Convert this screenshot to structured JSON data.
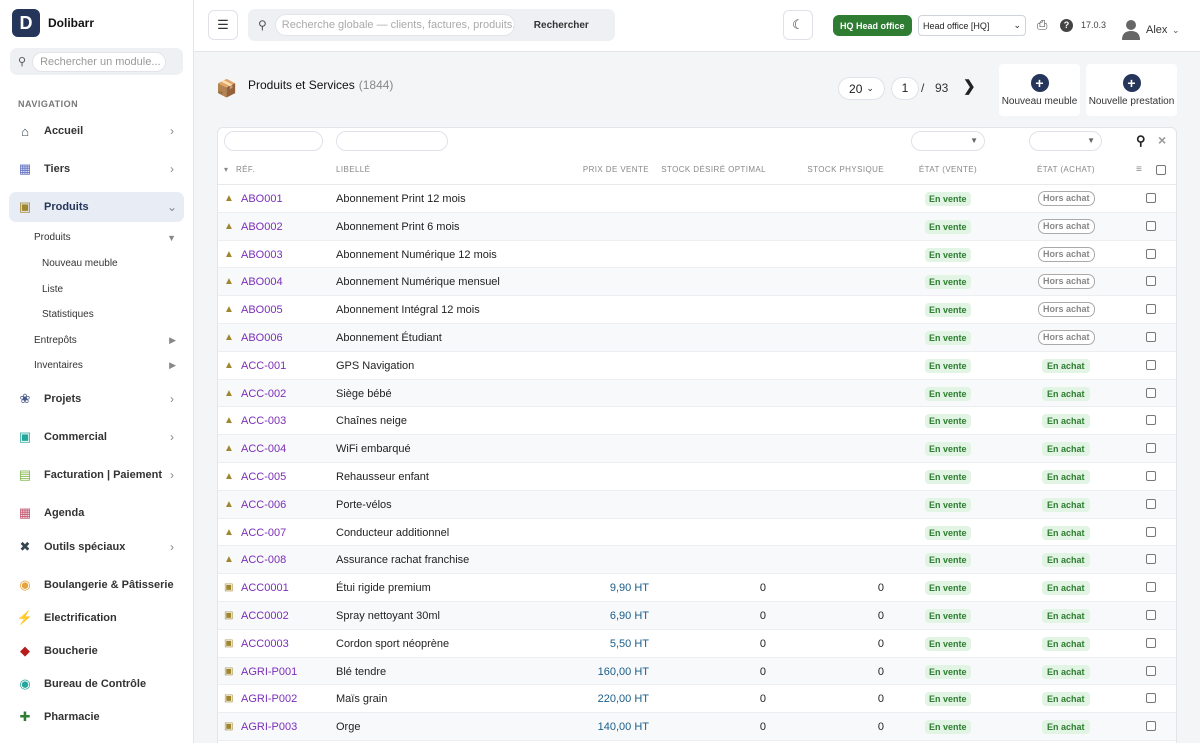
{
  "brand": {
    "logo_letter": "D",
    "name": "Dolibarr"
  },
  "module_search": {
    "placeholder": "Rechercher un module..."
  },
  "nav": {
    "heading": "NAVIGATION",
    "items": [
      {
        "label": "Accueil",
        "icon": "home-icon",
        "color": "#37474f"
      },
      {
        "label": "Tiers",
        "icon": "building-icon",
        "color": "#5c6bc0"
      },
      {
        "label": "Produits",
        "icon": "cube-icon",
        "color": "#a0872f"
      },
      {
        "label": "Projets",
        "icon": "project-icon",
        "color": "#4a5a8a"
      },
      {
        "label": "Commercial",
        "icon": "briefcase-icon",
        "color": "#26a69a"
      },
      {
        "label": "Facturation | Paiement",
        "icon": "invoice-icon",
        "color": "#7cb342"
      },
      {
        "label": "Agenda",
        "icon": "calendar-icon",
        "color": "#c0506a"
      },
      {
        "label": "Outils spéciaux",
        "icon": "tools-icon",
        "color": "#37474f"
      },
      {
        "label": "Boulangerie & Pâtisserie",
        "icon": "bread-icon",
        "color": "#e6a23c"
      },
      {
        "label": "Electrification",
        "icon": "bolt-icon",
        "color": "#f5b800"
      },
      {
        "label": "Boucherie",
        "icon": "meat-icon",
        "color": "#b71c1c"
      },
      {
        "label": "Bureau de Contrôle",
        "icon": "shield-icon",
        "color": "#26a69a"
      },
      {
        "label": "Pharmacie",
        "icon": "cross-icon",
        "color": "#2e7d32"
      }
    ],
    "sub": {
      "produits": "Produits",
      "nouveau": "Nouveau meuble",
      "liste": "Liste",
      "stats": "Statistiques",
      "entrepots": "Entrepôts",
      "inventaires": "Inventaires"
    }
  },
  "topbar": {
    "search_placeholder": "Recherche globale — clients, factures, produits...",
    "search_button": "Rechercher",
    "hq_badge": "HQ Head office",
    "entity": "Head office [HQ]",
    "version": "17.0.3",
    "user": "Alex"
  },
  "page": {
    "title": "Produits et Services",
    "count": "(1844)",
    "limit": "20",
    "page": "1",
    "sep": "/",
    "total_pages": "93",
    "action_new_product": "Nouveau meuble",
    "action_new_service": "Nouvelle prestation"
  },
  "table": {
    "headers": {
      "ref": "RÉF.",
      "label": "LIBELLÉ",
      "price": "PRIX DE VENTE",
      "stock_desired": "STOCK DÉSIRÉ OPTIMAL",
      "stock_physical": "STOCK PHYSIQUE",
      "state_sell": "ÉTAT (VENTE)",
      "state_buy": "ÉTAT (ACHAT)"
    },
    "rows": [
      {
        "type": "service",
        "ref": "ABO001",
        "label": "Abonnement Print 12 mois",
        "price": "",
        "desired": "",
        "physical": "",
        "sell": "En vente",
        "buy": "Hors achat",
        "buy_on": false
      },
      {
        "type": "service",
        "ref": "ABO002",
        "label": "Abonnement Print 6 mois",
        "price": "",
        "desired": "",
        "physical": "",
        "sell": "En vente",
        "buy": "Hors achat",
        "buy_on": false
      },
      {
        "type": "service",
        "ref": "ABO003",
        "label": "Abonnement Numérique 12 mois",
        "price": "",
        "desired": "",
        "physical": "",
        "sell": "En vente",
        "buy": "Hors achat",
        "buy_on": false
      },
      {
        "type": "service",
        "ref": "ABO004",
        "label": "Abonnement Numérique mensuel",
        "price": "",
        "desired": "",
        "physical": "",
        "sell": "En vente",
        "buy": "Hors achat",
        "buy_on": false
      },
      {
        "type": "service",
        "ref": "ABO005",
        "label": "Abonnement Intégral 12 mois",
        "price": "",
        "desired": "",
        "physical": "",
        "sell": "En vente",
        "buy": "Hors achat",
        "buy_on": false
      },
      {
        "type": "service",
        "ref": "ABO006",
        "label": "Abonnement Étudiant",
        "price": "",
        "desired": "",
        "physical": "",
        "sell": "En vente",
        "buy": "Hors achat",
        "buy_on": false
      },
      {
        "type": "service",
        "ref": "ACC-001",
        "label": "GPS Navigation",
        "price": "",
        "desired": "",
        "physical": "",
        "sell": "En vente",
        "buy": "En achat",
        "buy_on": true
      },
      {
        "type": "service",
        "ref": "ACC-002",
        "label": "Siège bébé",
        "price": "",
        "desired": "",
        "physical": "",
        "sell": "En vente",
        "buy": "En achat",
        "buy_on": true
      },
      {
        "type": "service",
        "ref": "ACC-003",
        "label": "Chaînes neige",
        "price": "",
        "desired": "",
        "physical": "",
        "sell": "En vente",
        "buy": "En achat",
        "buy_on": true
      },
      {
        "type": "service",
        "ref": "ACC-004",
        "label": "WiFi embarqué",
        "price": "",
        "desired": "",
        "physical": "",
        "sell": "En vente",
        "buy": "En achat",
        "buy_on": true
      },
      {
        "type": "service",
        "ref": "ACC-005",
        "label": "Rehausseur enfant",
        "price": "",
        "desired": "",
        "physical": "",
        "sell": "En vente",
        "buy": "En achat",
        "buy_on": true
      },
      {
        "type": "service",
        "ref": "ACC-006",
        "label": "Porte-vélos",
        "price": "",
        "desired": "",
        "physical": "",
        "sell": "En vente",
        "buy": "En achat",
        "buy_on": true
      },
      {
        "type": "service",
        "ref": "ACC-007",
        "label": "Conducteur additionnel",
        "price": "",
        "desired": "",
        "physical": "",
        "sell": "En vente",
        "buy": "En achat",
        "buy_on": true
      },
      {
        "type": "service",
        "ref": "ACC-008",
        "label": "Assurance rachat franchise",
        "price": "",
        "desired": "",
        "physical": "",
        "sell": "En vente",
        "buy": "En achat",
        "buy_on": true
      },
      {
        "type": "product",
        "ref": "ACC0001",
        "label": "Étui rigide premium",
        "price": "9,90 HT",
        "desired": "0",
        "physical": "0",
        "sell": "En vente",
        "buy": "En achat",
        "buy_on": true
      },
      {
        "type": "product",
        "ref": "ACC0002",
        "label": "Spray nettoyant 30ml",
        "price": "6,90 HT",
        "desired": "0",
        "physical": "0",
        "sell": "En vente",
        "buy": "En achat",
        "buy_on": true
      },
      {
        "type": "product",
        "ref": "ACC0003",
        "label": "Cordon sport néoprène",
        "price": "5,50 HT",
        "desired": "0",
        "physical": "0",
        "sell": "En vente",
        "buy": "En achat",
        "buy_on": true
      },
      {
        "type": "product",
        "ref": "AGRI-P001",
        "label": "Blé tendre",
        "price": "160,00 HT",
        "desired": "0",
        "physical": "0",
        "sell": "En vente",
        "buy": "En achat",
        "buy_on": true
      },
      {
        "type": "product",
        "ref": "AGRI-P002",
        "label": "Maïs grain",
        "price": "220,00 HT",
        "desired": "0",
        "physical": "0",
        "sell": "En vente",
        "buy": "En achat",
        "buy_on": true
      },
      {
        "type": "product",
        "ref": "AGRI-P003",
        "label": "Orge",
        "price": "140,00 HT",
        "desired": "0",
        "physical": "0",
        "sell": "En vente",
        "buy": "En achat",
        "buy_on": true
      }
    ]
  },
  "colors": {
    "brand": "#25365a",
    "ref_link": "#7b2eb8",
    "price": "#1a5e8a",
    "badge_green": "#2e7d32"
  }
}
